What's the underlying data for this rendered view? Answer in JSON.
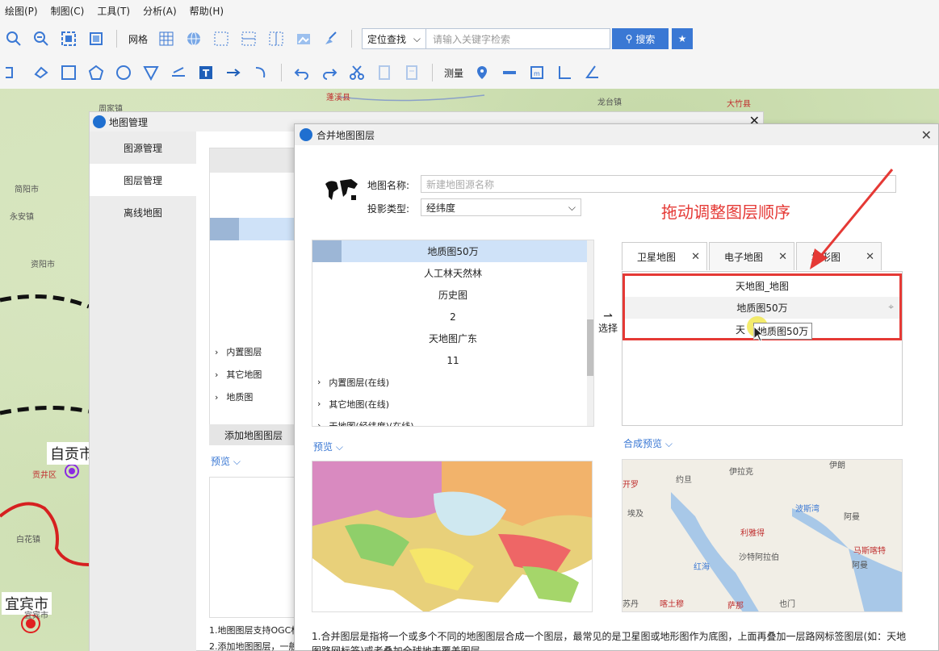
{
  "menu": [
    "绘图(P)",
    "制图(C)",
    "工具(T)",
    "分析(A)",
    "帮助(H)"
  ],
  "toolbar1": {
    "grid_label": "网格",
    "search_mode": "定位查找",
    "search_placeholder": "请输入关键字检索",
    "search_button": "搜索"
  },
  "toolbar2": {
    "measure_label": "测量"
  },
  "map": {
    "labels": [
      "简阳市",
      "资阳市",
      "自贡市",
      "宜宾市",
      "永安镇",
      "周家镇",
      "蓬溪县",
      "龙台镇",
      "大竹县",
      "宜宾市",
      "贡井区",
      "白花镇"
    ]
  },
  "map_manager": {
    "title": "地图管理",
    "sidebar": [
      "图源管理",
      "图层管理",
      "离线地图"
    ],
    "groups": [
      "内置图层",
      "其它地图",
      "地质图"
    ],
    "add_button": "添加地图图层",
    "preview_label": "预览",
    "notes": [
      "1.地图图层支持OGC标",
      "2.添加地图图层，一般"
    ]
  },
  "merge_dialog": {
    "title": "合并地图图层",
    "name_label": "地图名称:",
    "name_placeholder": "新建地图源名称",
    "proj_label": "投影类型:",
    "proj_value": "经纬度",
    "source_items": [
      "地质图50万",
      "人工林天然林",
      "历史图",
      "2",
      "天地图广东",
      "11"
    ],
    "source_groups": [
      "内置图层(在线)",
      "其它地图(在线)",
      "天地图(经纬度)(在线)"
    ],
    "select_button": "选择",
    "tabs": [
      "卫星地图",
      "电子地图",
      "地形图"
    ],
    "layers": [
      "天地图_地图",
      "地质图50万",
      "天"
    ],
    "drag_tooltip": "地质图50万",
    "annotation": "拖动调整图层顺序",
    "preview_label": "预览",
    "composite_preview_label": "合成预览",
    "note": "1.合并图层是指将一个或多个不同的地图图层合成一个图层，最常见的是卫星图或地形图作为底图，上面再叠加一层路网标签图层(如：天地图路网标签)或者叠加全球地表覆盖图层。",
    "composite_map_labels": [
      "伊拉克",
      "约旦",
      "伊朗",
      "开罗",
      "埃及",
      "波斯湾",
      "阿曼",
      "利雅得",
      "沙特阿拉伯",
      "马斯喀特",
      "红海",
      "阿曼",
      "苏丹",
      "喀土穆",
      "萨那",
      "也门"
    ]
  },
  "colors": {
    "accent": "#3a78d4",
    "annotation_red": "#e53935"
  }
}
